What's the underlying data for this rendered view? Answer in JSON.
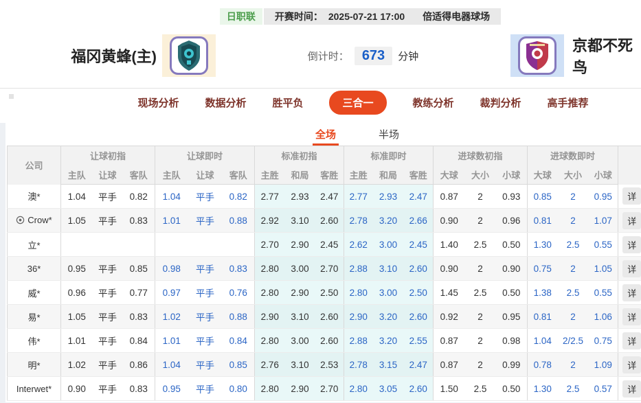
{
  "match": {
    "league": "日职联",
    "kickoff_label": "开赛时间：",
    "kickoff_time": "2025-07-21 17:00",
    "venue": "倍适得电器球场",
    "home_team": "福冈黄蜂(主)",
    "away_team": "京都不死鸟",
    "countdown_label": "倒计时：",
    "countdown_minutes": "673",
    "countdown_unit": "分钟"
  },
  "nav_tabs": [
    {
      "label": "现场分析",
      "active": false
    },
    {
      "label": "数据分析",
      "active": false
    },
    {
      "label": "胜平负",
      "active": false
    },
    {
      "label": "三合一",
      "active": true
    },
    {
      "label": "教练分析",
      "active": false
    },
    {
      "label": "裁判分析",
      "active": false
    },
    {
      "label": "高手推荐",
      "active": false
    }
  ],
  "scope_tabs": [
    {
      "label": "全场",
      "active": true
    },
    {
      "label": "半场",
      "active": false
    }
  ],
  "odds_table": {
    "company_header": "公司",
    "group_headers": [
      "让球初指",
      "让球即时",
      "标准初指",
      "标准即时",
      "进球数初指",
      "进球数即时"
    ],
    "sub_headers": [
      "主队",
      "让球",
      "客队",
      "主队",
      "让球",
      "客队",
      "主胜",
      "和局",
      "客胜",
      "主胜",
      "和局",
      "客胜",
      "大球",
      "大小",
      "小球",
      "大球",
      "大小",
      "小球"
    ],
    "detail_label": "详",
    "rows": [
      {
        "company": "澳*",
        "icon": false,
        "odds": [
          "1.04",
          "平手",
          "0.82",
          "1.04",
          "平手",
          "0.82",
          "2.77",
          "2.93",
          "2.47",
          "2.77",
          "2.93",
          "2.47",
          "0.87",
          "2",
          "0.93",
          "0.85",
          "2",
          "0.95"
        ]
      },
      {
        "company": "Crow*",
        "icon": true,
        "odds": [
          "1.05",
          "平手",
          "0.83",
          "1.01",
          "平手",
          "0.88",
          "2.92",
          "3.10",
          "2.60",
          "2.78",
          "3.20",
          "2.66",
          "0.90",
          "2",
          "0.96",
          "0.81",
          "2",
          "1.07"
        ]
      },
      {
        "company": "立*",
        "icon": false,
        "odds": [
          "",
          "",
          "",
          "",
          "",
          "",
          "2.70",
          "2.90",
          "2.45",
          "2.62",
          "3.00",
          "2.45",
          "1.40",
          "2.5",
          "0.50",
          "1.30",
          "2.5",
          "0.55"
        ]
      },
      {
        "company": "36*",
        "icon": false,
        "odds": [
          "0.95",
          "平手",
          "0.85",
          "0.98",
          "平手",
          "0.83",
          "2.80",
          "3.00",
          "2.70",
          "2.88",
          "3.10",
          "2.60",
          "0.90",
          "2",
          "0.90",
          "0.75",
          "2",
          "1.05"
        ]
      },
      {
        "company": "威*",
        "icon": false,
        "odds": [
          "0.96",
          "平手",
          "0.77",
          "0.97",
          "平手",
          "0.76",
          "2.80",
          "2.90",
          "2.50",
          "2.80",
          "3.00",
          "2.50",
          "1.45",
          "2.5",
          "0.50",
          "1.38",
          "2.5",
          "0.55"
        ]
      },
      {
        "company": "易*",
        "icon": false,
        "odds": [
          "1.05",
          "平手",
          "0.83",
          "1.02",
          "平手",
          "0.88",
          "2.90",
          "3.10",
          "2.60",
          "2.90",
          "3.20",
          "2.60",
          "0.92",
          "2",
          "0.95",
          "0.81",
          "2",
          "1.06"
        ]
      },
      {
        "company": "伟*",
        "icon": false,
        "odds": [
          "1.01",
          "平手",
          "0.84",
          "1.01",
          "平手",
          "0.84",
          "2.80",
          "3.00",
          "2.60",
          "2.88",
          "3.20",
          "2.55",
          "0.87",
          "2",
          "0.98",
          "1.04",
          "2/2.5",
          "0.75"
        ]
      },
      {
        "company": "明*",
        "icon": false,
        "odds": [
          "1.02",
          "平手",
          "0.86",
          "1.04",
          "平手",
          "0.85",
          "2.76",
          "3.10",
          "2.53",
          "2.78",
          "3.15",
          "2.47",
          "0.87",
          "2",
          "0.99",
          "0.78",
          "2",
          "1.09"
        ]
      },
      {
        "company": "Interwet*",
        "icon": false,
        "odds": [
          "0.90",
          "平手",
          "0.83",
          "0.95",
          "平手",
          "0.80",
          "2.80",
          "2.90",
          "2.70",
          "2.80",
          "3.05",
          "2.60",
          "1.50",
          "2.5",
          "0.50",
          "1.30",
          "2.5",
          "0.57"
        ]
      }
    ]
  },
  "colors": {
    "accent_orange": "#e8491f",
    "live_odds_blue": "#2b65c5",
    "countdown_blue": "#1a5fc8",
    "league_green": "#4d9e4d",
    "standard_col_bg": "#e9f8f8",
    "page_bg": "#edf0f4"
  }
}
